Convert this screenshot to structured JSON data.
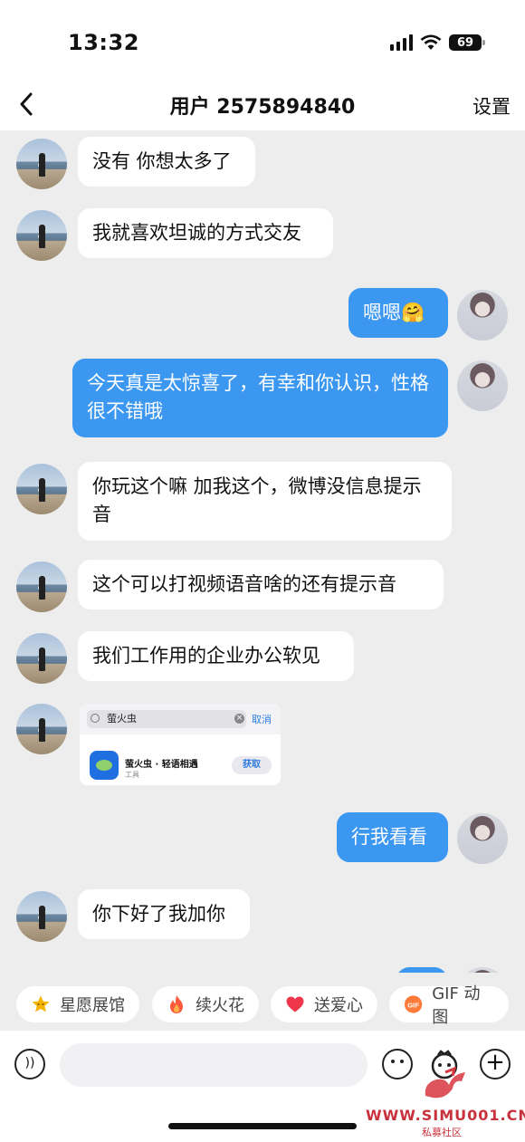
{
  "status": {
    "time": "13:32",
    "battery": "69"
  },
  "nav": {
    "title": "用户 2575894840",
    "settings": "设置"
  },
  "messages": [
    {
      "side": "in",
      "text": "没有 你想太多了"
    },
    {
      "side": "in",
      "text": "我就喜欢坦诚的方式交友"
    },
    {
      "side": "out",
      "text": "嗯嗯🤗"
    },
    {
      "side": "out",
      "text": "今天真是太惊喜了，有幸和你认识，性格很不错哦"
    },
    {
      "side": "in",
      "text": "你玩这个嘛 加我这个，微博没信息提示音"
    },
    {
      "side": "in",
      "text": "这个可以打视频语音啥的还有提示音"
    },
    {
      "side": "in",
      "text": "我们工作用的企业办公软见"
    },
    {
      "side": "out",
      "text": "行我看看"
    },
    {
      "side": "in",
      "text": "你下好了我加你"
    }
  ],
  "image_card": {
    "search_text": "萤火虫",
    "cancel": "取消",
    "app_name": "萤火虫 · 轻语相遇",
    "app_category": "工具",
    "get_button": "获取"
  },
  "quick_actions": [
    {
      "label": "星愿展馆",
      "icon": "star-icon",
      "color": "#f5b400"
    },
    {
      "label": "续火花",
      "icon": "flame-icon",
      "color": "#ff5a3c"
    },
    {
      "label": "送爱心",
      "icon": "heart-icon",
      "color": "#f0364a"
    },
    {
      "label": "GIF 动图",
      "icon": "gif-icon",
      "color": "#ff7b3a"
    }
  ],
  "input": {
    "placeholder": ""
  },
  "watermark": {
    "site": "WWW.SIMU001.CN",
    "sub": "私募社区"
  },
  "colors": {
    "out_bubble": "#3b97f0",
    "in_bubble": "#ffffff",
    "background": "#ededed"
  }
}
